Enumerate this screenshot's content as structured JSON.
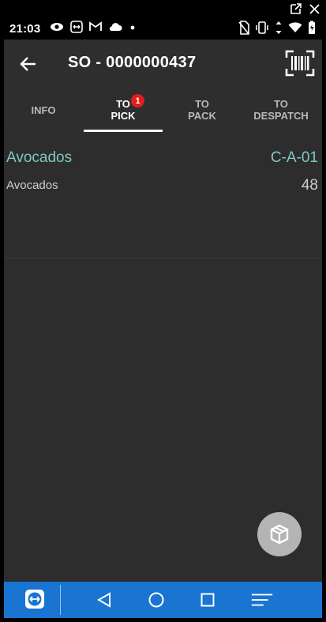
{
  "status_bar": {
    "time": "21:03"
  },
  "app_bar": {
    "title": "SO - 0000000437"
  },
  "tabs": [
    {
      "line1": "INFO",
      "line2": ""
    },
    {
      "line1": "TO",
      "line2": "PICK"
    },
    {
      "line1": "TO",
      "line2": "PACK"
    },
    {
      "line1": "TO",
      "line2": "DESPATCH"
    }
  ],
  "active_tab": "TO PICK",
  "pick_badge": "1",
  "items": [
    {
      "name": "Avocados",
      "location": "C-A-01",
      "description": "Avocados",
      "quantity": "48"
    }
  ],
  "colors": {
    "accent": "#7ec9c4",
    "badge": "#e31c1c",
    "nav_bar": "#1a74d1",
    "background": "#2d2d2d"
  }
}
